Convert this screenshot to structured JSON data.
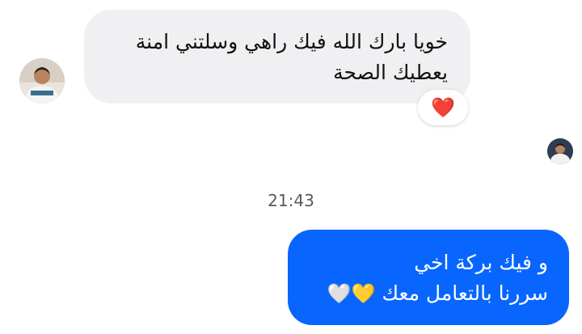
{
  "incoming_message": {
    "line1": "خويا بارك الله فيك راهي وسلتني امنة",
    "line2": "يعطيك الصحة",
    "reaction_icon": "red-heart-icon",
    "reaction_glyph": "❤️"
  },
  "timestamp": "21:43",
  "outgoing_message": {
    "line1": "و فيك بركة اخي",
    "line2": "سررنا بالتعامل معك",
    "emoji_yellow": "💛",
    "emoji_white": "🤍"
  },
  "colors": {
    "incoming_bubble": "#f0f0f2",
    "outgoing_bubble": "#0866ff",
    "outgoing_text": "#ffffff"
  }
}
